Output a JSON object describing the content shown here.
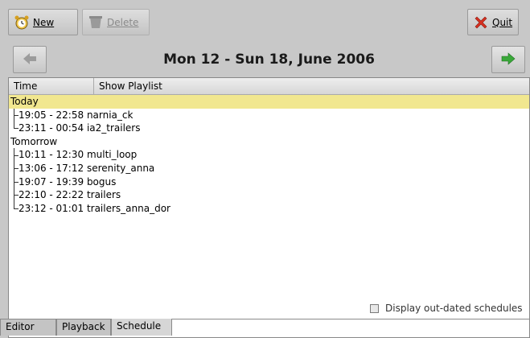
{
  "toolbar": {
    "new_label": "New",
    "delete_label": "Delete",
    "quit_label": "Quit"
  },
  "nav": {
    "title": "Mon 12 - Sun 18, June 2006"
  },
  "list": {
    "columns": [
      "Time",
      "Show Playlist"
    ],
    "rows": [
      {
        "text": "Today",
        "type": "group",
        "selected": true
      },
      {
        "text": "19:05 - 22:58 narnia_ck",
        "type": "item"
      },
      {
        "text": "23:11 - 00:54 ia2_trailers",
        "type": "item-last"
      },
      {
        "text": "Tomorrow",
        "type": "group"
      },
      {
        "text": "10:11 - 12:30 multi_loop",
        "type": "item"
      },
      {
        "text": "13:06 - 17:12 serenity_anna",
        "type": "item"
      },
      {
        "text": "19:07 - 19:39 bogus",
        "type": "item"
      },
      {
        "text": "22:10 - 22:22 trailers",
        "type": "item"
      },
      {
        "text": "23:12 - 01:01 trailers_anna_dor",
        "type": "item-last"
      }
    ]
  },
  "outdated_label": "Display out-dated schedules",
  "tabs": [
    "Editor",
    "Playback",
    "Schedule"
  ],
  "active_tab": "Schedule",
  "colors": {
    "selection": "#f1e78f",
    "quit_icon": "#d83020",
    "next_arrow": "#3aa83a"
  }
}
